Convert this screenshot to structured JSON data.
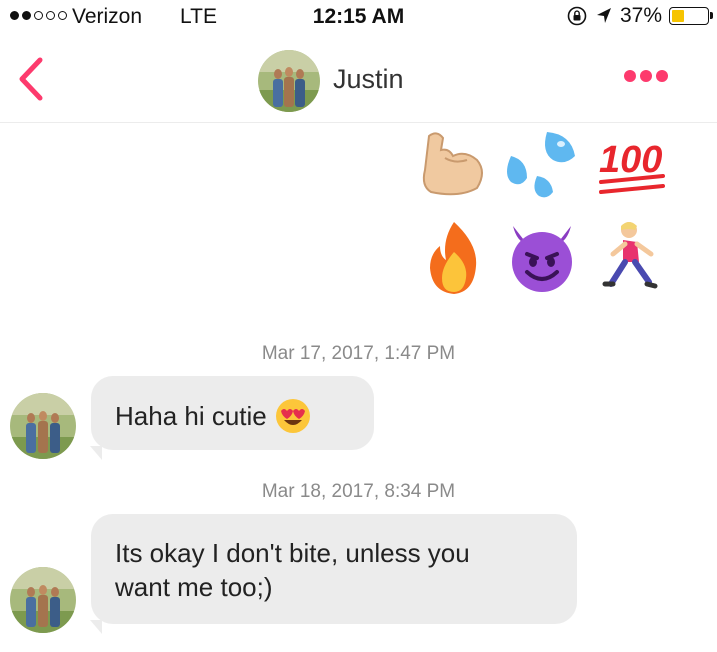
{
  "status_bar": {
    "carrier": "Verizon",
    "network": "LTE",
    "time": "12:15 AM",
    "battery_percent": "37%",
    "battery_level": 0.37,
    "signal_bars_filled": 2,
    "signal_bars_total": 5
  },
  "header": {
    "contact_name": "Justin",
    "back_icon": "chevron-left-icon",
    "more_icon": "more-dots-icon",
    "accent_color": "#fd3a6d"
  },
  "emoji_message": {
    "emojis": [
      "flexed-biceps",
      "sweat-droplets",
      "hundred-points",
      "fire",
      "smiling-face-with-horns",
      "person-running"
    ]
  },
  "messages": [
    {
      "timestamp": "Mar 17, 2017, 1:47 PM",
      "text": "Haha hi cutie",
      "emoji": "smiling-face-with-heart-eyes"
    },
    {
      "timestamp": "Mar 18, 2017, 8:34 PM",
      "text_line1": "Its okay I don't bite, unless you",
      "text_line2": "want me too;)"
    }
  ],
  "colors": {
    "incoming_bubble": "#ececec",
    "timestamp_text": "#8a8a8a"
  }
}
